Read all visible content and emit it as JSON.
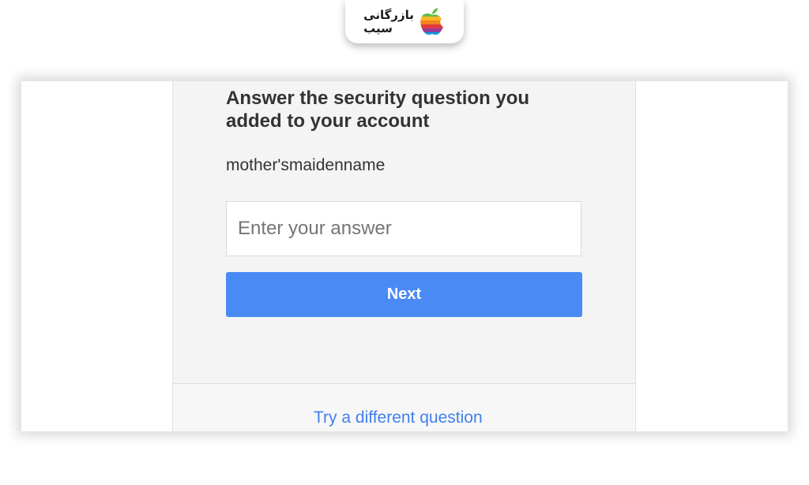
{
  "branding": {
    "logo_line1": "بازرگانی",
    "logo_line2": "سیب",
    "icon": "apple-logo-icon"
  },
  "form": {
    "heading": "Answer the security question you added to your account",
    "question": "mother'smaidenname",
    "answer_placeholder": "Enter your answer",
    "answer_value": "",
    "next_label": "Next",
    "alt_link": "Try a different question"
  },
  "colors": {
    "primary_button": "#4a8af4",
    "link": "#427fed",
    "text": "#333333",
    "card_background": "#f4f4f4"
  }
}
